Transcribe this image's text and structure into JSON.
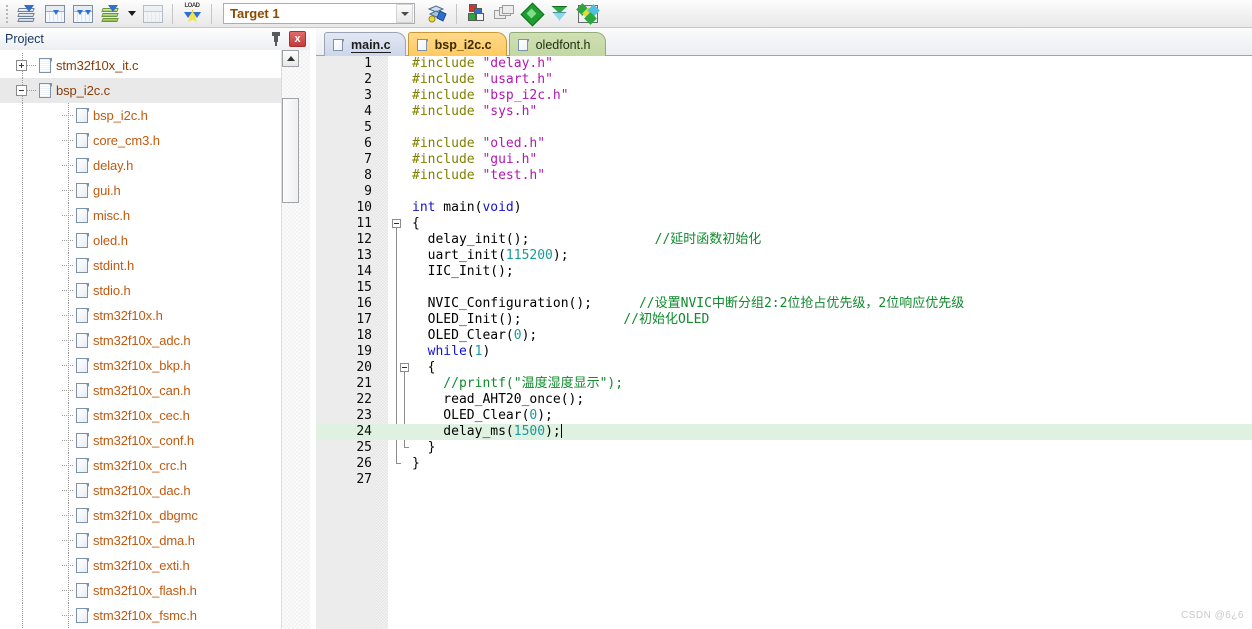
{
  "toolbar": {
    "buttons": [
      {
        "name": "download-to-flash-icon",
        "tip": "Download"
      },
      {
        "name": "translate-file-icon",
        "tip": "Translate"
      },
      {
        "name": "build-target-icon",
        "tip": "Build"
      },
      {
        "name": "rebuild-all-icon",
        "tip": "Rebuild"
      },
      {
        "name": "batch-build-icon",
        "tip": "Batch Build"
      },
      {
        "name": "load-to-flash-icon",
        "tip": "Download to flash"
      }
    ],
    "target_label": "Target 1",
    "target_dropdown_icon": "chevron-down-icon",
    "right_buttons": [
      {
        "name": "target-options-icon",
        "tip": "Options for Target"
      },
      {
        "name": "manage-project-items-icon",
        "tip": "Manage Project Items"
      },
      {
        "name": "multi-project-window-icon",
        "tip": "Multi-Project Window"
      },
      {
        "name": "pack-installer-icon",
        "tip": "Pack Installer"
      },
      {
        "name": "manage-run-time-env-icon",
        "tip": "Manage Run-Time Environment"
      },
      {
        "name": "select-software-packs-icon",
        "tip": "Select Software Packs"
      }
    ]
  },
  "project_panel": {
    "title": "Project",
    "pin_icon": "pin-icon",
    "close_label": "x",
    "tree": [
      {
        "label": "stm32f10x_it.c",
        "depth": 0,
        "toggle": "plus",
        "icon": "source-file-icon",
        "selected": false
      },
      {
        "label": "bsp_i2c.c",
        "depth": 0,
        "toggle": "minus",
        "icon": "source-file-icon",
        "selected": true
      },
      {
        "label": "bsp_i2c.h",
        "depth": 1,
        "toggle": "none",
        "icon": "header-file-icon",
        "selected": false
      },
      {
        "label": "core_cm3.h",
        "depth": 1,
        "toggle": "none",
        "icon": "header-file-icon",
        "selected": false
      },
      {
        "label": "delay.h",
        "depth": 1,
        "toggle": "none",
        "icon": "header-file-icon",
        "selected": false
      },
      {
        "label": "gui.h",
        "depth": 1,
        "toggle": "none",
        "icon": "header-file-icon",
        "selected": false
      },
      {
        "label": "misc.h",
        "depth": 1,
        "toggle": "none",
        "icon": "header-file-icon",
        "selected": false
      },
      {
        "label": "oled.h",
        "depth": 1,
        "toggle": "none",
        "icon": "header-file-icon",
        "selected": false
      },
      {
        "label": "stdint.h",
        "depth": 1,
        "toggle": "none",
        "icon": "header-file-icon",
        "selected": false
      },
      {
        "label": "stdio.h",
        "depth": 1,
        "toggle": "none",
        "icon": "header-file-icon",
        "selected": false
      },
      {
        "label": "stm32f10x.h",
        "depth": 1,
        "toggle": "none",
        "icon": "header-file-icon",
        "selected": false
      },
      {
        "label": "stm32f10x_adc.h",
        "depth": 1,
        "toggle": "none",
        "icon": "header-file-icon",
        "selected": false
      },
      {
        "label": "stm32f10x_bkp.h",
        "depth": 1,
        "toggle": "none",
        "icon": "header-file-icon",
        "selected": false
      },
      {
        "label": "stm32f10x_can.h",
        "depth": 1,
        "toggle": "none",
        "icon": "header-file-icon",
        "selected": false
      },
      {
        "label": "stm32f10x_cec.h",
        "depth": 1,
        "toggle": "none",
        "icon": "header-file-icon",
        "selected": false
      },
      {
        "label": "stm32f10x_conf.h",
        "depth": 1,
        "toggle": "none",
        "icon": "header-file-icon",
        "selected": false
      },
      {
        "label": "stm32f10x_crc.h",
        "depth": 1,
        "toggle": "none",
        "icon": "header-file-icon",
        "selected": false
      },
      {
        "label": "stm32f10x_dac.h",
        "depth": 1,
        "toggle": "none",
        "icon": "header-file-icon",
        "selected": false
      },
      {
        "label": "stm32f10x_dbgmc",
        "depth": 1,
        "toggle": "none",
        "icon": "header-file-icon",
        "selected": false
      },
      {
        "label": "stm32f10x_dma.h",
        "depth": 1,
        "toggle": "none",
        "icon": "header-file-icon",
        "selected": false
      },
      {
        "label": "stm32f10x_exti.h",
        "depth": 1,
        "toggle": "none",
        "icon": "header-file-icon",
        "selected": false
      },
      {
        "label": "stm32f10x_flash.h",
        "depth": 1,
        "toggle": "none",
        "icon": "header-file-icon",
        "selected": false
      },
      {
        "label": "stm32f10x_fsmc.h",
        "depth": 1,
        "toggle": "none",
        "icon": "header-file-icon",
        "selected": false
      }
    ]
  },
  "editor": {
    "tabs": [
      {
        "label": "main.c",
        "active": true,
        "icon": "file-icon"
      },
      {
        "label": "bsp_i2c.c",
        "active": false,
        "icon": "file-icon"
      },
      {
        "label": "oledfont.h",
        "active": false,
        "icon": "file-icon"
      }
    ],
    "active_line": 24,
    "total_lines": 27,
    "lines": [
      {
        "n": "1",
        "tokens": [
          {
            "t": "#include ",
            "c": "pre"
          },
          {
            "t": "\"delay.h\"",
            "c": "str"
          }
        ]
      },
      {
        "n": "2",
        "tokens": [
          {
            "t": "#include ",
            "c": "pre"
          },
          {
            "t": "\"usart.h\"",
            "c": "str"
          }
        ]
      },
      {
        "n": "3",
        "tokens": [
          {
            "t": "#include ",
            "c": "pre"
          },
          {
            "t": "\"bsp_i2c.h\"",
            "c": "str"
          }
        ]
      },
      {
        "n": "4",
        "tokens": [
          {
            "t": "#include ",
            "c": "pre"
          },
          {
            "t": "\"sys.h\"",
            "c": "str"
          }
        ]
      },
      {
        "n": "5",
        "tokens": []
      },
      {
        "n": "6",
        "tokens": [
          {
            "t": "#include ",
            "c": "pre"
          },
          {
            "t": "\"oled.h\"",
            "c": "str"
          }
        ]
      },
      {
        "n": "7",
        "tokens": [
          {
            "t": "#include ",
            "c": "pre"
          },
          {
            "t": "\"gui.h\"",
            "c": "str"
          }
        ]
      },
      {
        "n": "8",
        "tokens": [
          {
            "t": "#include ",
            "c": "pre"
          },
          {
            "t": "\"test.h\"",
            "c": "str"
          }
        ]
      },
      {
        "n": "9",
        "tokens": []
      },
      {
        "n": "10",
        "tokens": [
          {
            "t": "int",
            "c": "kw"
          },
          {
            "t": " main(",
            "c": "pln"
          },
          {
            "t": "void",
            "c": "kw"
          },
          {
            "t": ")",
            "c": "pln"
          }
        ]
      },
      {
        "n": "11",
        "tokens": [
          {
            "t": "{",
            "c": "pln"
          }
        ]
      },
      {
        "n": "12",
        "tokens": [
          {
            "t": "  delay_init();",
            "c": "pln"
          },
          {
            "t": "                ",
            "c": "pln"
          },
          {
            "t": "//延时函数初始化",
            "c": "cmt"
          }
        ]
      },
      {
        "n": "13",
        "tokens": [
          {
            "t": "  uart_init(",
            "c": "pln"
          },
          {
            "t": "115200",
            "c": "num"
          },
          {
            "t": ");",
            "c": "pln"
          }
        ]
      },
      {
        "n": "14",
        "tokens": [
          {
            "t": "  IIC_Init();",
            "c": "pln"
          }
        ]
      },
      {
        "n": "15",
        "tokens": []
      },
      {
        "n": "16",
        "tokens": [
          {
            "t": "  NVIC_Configuration();",
            "c": "pln"
          },
          {
            "t": "      ",
            "c": "pln"
          },
          {
            "t": "//设置NVIC中断分组2:2位抢占优先级，2位响应优先级",
            "c": "cmt"
          }
        ]
      },
      {
        "n": "17",
        "tokens": [
          {
            "t": "  OLED_Init();",
            "c": "pln"
          },
          {
            "t": "             ",
            "c": "pln"
          },
          {
            "t": "//初始化OLED",
            "c": "cmt"
          }
        ]
      },
      {
        "n": "18",
        "tokens": [
          {
            "t": "  OLED_Clear(",
            "c": "pln"
          },
          {
            "t": "0",
            "c": "num"
          },
          {
            "t": ");",
            "c": "pln"
          }
        ]
      },
      {
        "n": "19",
        "tokens": [
          {
            "t": "  ",
            "c": "pln"
          },
          {
            "t": "while",
            "c": "kw"
          },
          {
            "t": "(",
            "c": "pln"
          },
          {
            "t": "1",
            "c": "num"
          },
          {
            "t": ")",
            "c": "pln"
          }
        ]
      },
      {
        "n": "20",
        "tokens": [
          {
            "t": "  {",
            "c": "pln"
          }
        ]
      },
      {
        "n": "21",
        "tokens": [
          {
            "t": "    //printf(\"温度湿度显示\");",
            "c": "cmt"
          }
        ]
      },
      {
        "n": "22",
        "tokens": [
          {
            "t": "    read_AHT20_once();",
            "c": "pln"
          }
        ]
      },
      {
        "n": "23",
        "tokens": [
          {
            "t": "    OLED_Clear(",
            "c": "pln"
          },
          {
            "t": "0",
            "c": "num"
          },
          {
            "t": ");",
            "c": "pln"
          }
        ]
      },
      {
        "n": "24",
        "tokens": [
          {
            "t": "    delay_ms(",
            "c": "pln"
          },
          {
            "t": "1500",
            "c": "num"
          },
          {
            "t": ");",
            "c": "pln"
          }
        ],
        "highlight": true,
        "caret": true
      },
      {
        "n": "25",
        "tokens": [
          {
            "t": "  }",
            "c": "pln"
          }
        ]
      },
      {
        "n": "26",
        "tokens": [
          {
            "t": "}",
            "c": "pln"
          }
        ]
      },
      {
        "n": "27",
        "tokens": []
      }
    ]
  },
  "watermark": "CSDN @6¿6",
  "colors": {
    "preprocessor": "#808000",
    "string": "#b118b1",
    "keyword": "#1515cc",
    "number": "#1a9a9a",
    "comment": "#108b2e",
    "highlight_line": "#dff2e1",
    "tree_label": "#c05a10",
    "target_label": "#8c4a00"
  }
}
